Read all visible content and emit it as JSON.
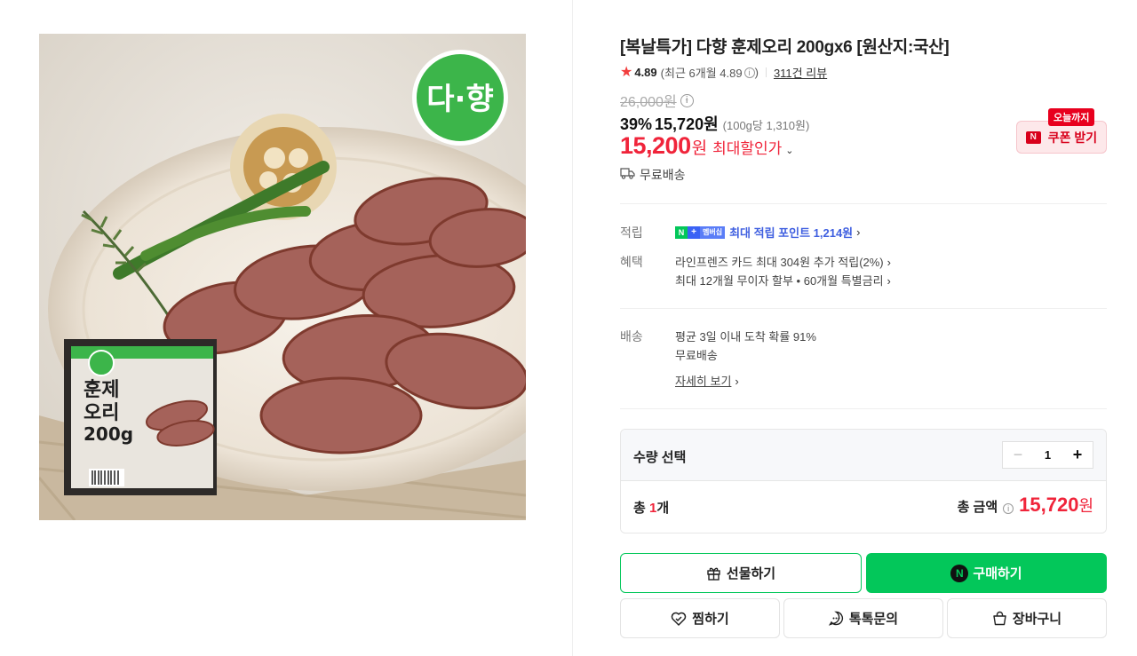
{
  "product": {
    "title": "[복날특가] 다향 훈제오리 200gx6 [원산지:국산]",
    "image_alt": "다향 훈제오리 상품 이미지",
    "logo_text": "다·향",
    "package_text": [
      "훈제",
      "오리",
      "200g"
    ]
  },
  "rating": {
    "score": "4.89",
    "recent": "(최근 6개월 4.89",
    "recent_close": ")",
    "reviews": "311건 리뷰"
  },
  "price": {
    "original": "26,000원",
    "discount": "39%",
    "sale": "15,720원",
    "unit": "(100g당 1,310원)",
    "max_price": "15,200",
    "max_won": "원",
    "max_label": "최대할인가"
  },
  "coupon": {
    "tag": "오늘까지",
    "button": "쿠폰 받기",
    "n_mark": "N"
  },
  "shipping_label": "무료배송",
  "details": {
    "points_label": "적립",
    "points_badge_n": "N",
    "points_badge_plus": "+",
    "points_badge_member": "멤버십",
    "points_text": "최대 적립 포인트 1,214원",
    "benefit_label": "혜택",
    "benefit_1": "라인프렌즈 카드 최대 304원 추가 적립(2%)",
    "benefit_2": "최대 12개월 무이자 할부 • 60개월 특별금리",
    "delivery_label": "배송",
    "delivery_1": "평균 3일 이내 도착 확률 91%",
    "delivery_2": "무료배송",
    "delivery_more": "자세히 보기"
  },
  "quantity": {
    "label": "수량 선택",
    "minus": "−",
    "value": "1",
    "plus": "+",
    "total_prefix": "총 ",
    "total_count": "1",
    "total_suffix": "개",
    "total_amount_label": "총 금액",
    "total_amount": "15,720",
    "total_won": "원"
  },
  "buttons": {
    "gift": "선물하기",
    "buy": "구매하기",
    "buy_n": "N",
    "wish": "찜하기",
    "talk": "톡톡문의",
    "cart": "장바구니"
  },
  "colors": {
    "naver_green": "#03c75a",
    "sale_red": "#f0243a",
    "points_blue": "#3f5fe0"
  }
}
